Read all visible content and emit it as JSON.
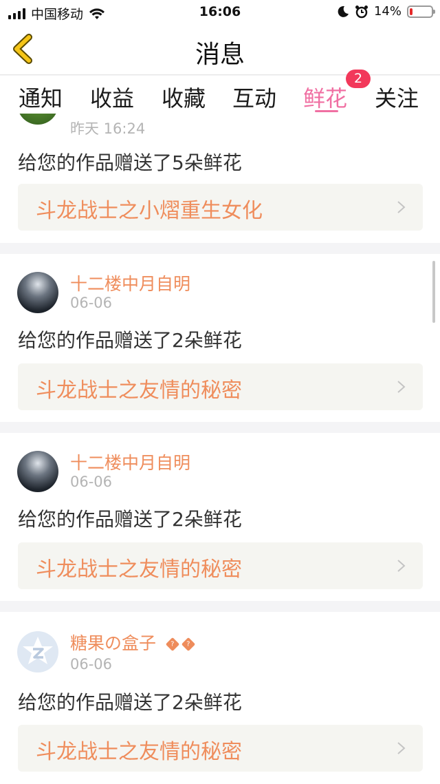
{
  "status_bar": {
    "carrier": "中国移动",
    "time": "16:06",
    "battery_percent": "14%",
    "battery_level": 0.14,
    "icons": [
      "signal-icon",
      "wifi-icon",
      "moon-icon",
      "alarm-icon",
      "battery-icon"
    ]
  },
  "nav": {
    "title": "消息",
    "back_icon": "chevron-left-icon",
    "accent_color": "#f5c518"
  },
  "tabs": [
    {
      "label": "通知"
    },
    {
      "label": "收益"
    },
    {
      "label": "收藏"
    },
    {
      "label": "互动"
    },
    {
      "label": "鲜花",
      "active": true,
      "badge": "2"
    },
    {
      "label": "关注"
    }
  ],
  "colors": {
    "active_tab": "#f06fa2",
    "badge": "#f2385a",
    "link_text": "#ef8d5c",
    "date_text": "#b4b4b4"
  },
  "messages": [
    {
      "date": "昨天 16:24",
      "text": "给您的作品赠送了5朵鲜花",
      "work": "斗龙战士之小熠重生女化"
    },
    {
      "user": "十二楼中月自明",
      "date": "06-06",
      "text": "给您的作品赠送了2朵鲜花",
      "work": "斗龙战士之友情的秘密"
    },
    {
      "user": "十二楼中月自明",
      "date": "06-06",
      "text": "给您的作品赠送了2朵鲜花",
      "work": "斗龙战士之友情的秘密"
    },
    {
      "user": "糖果の盒子",
      "user_badges": [
        "?",
        "?"
      ],
      "date": "06-06",
      "text": "给您的作品赠送了2朵鲜花",
      "work": "斗龙战士之友情的秘密"
    }
  ]
}
